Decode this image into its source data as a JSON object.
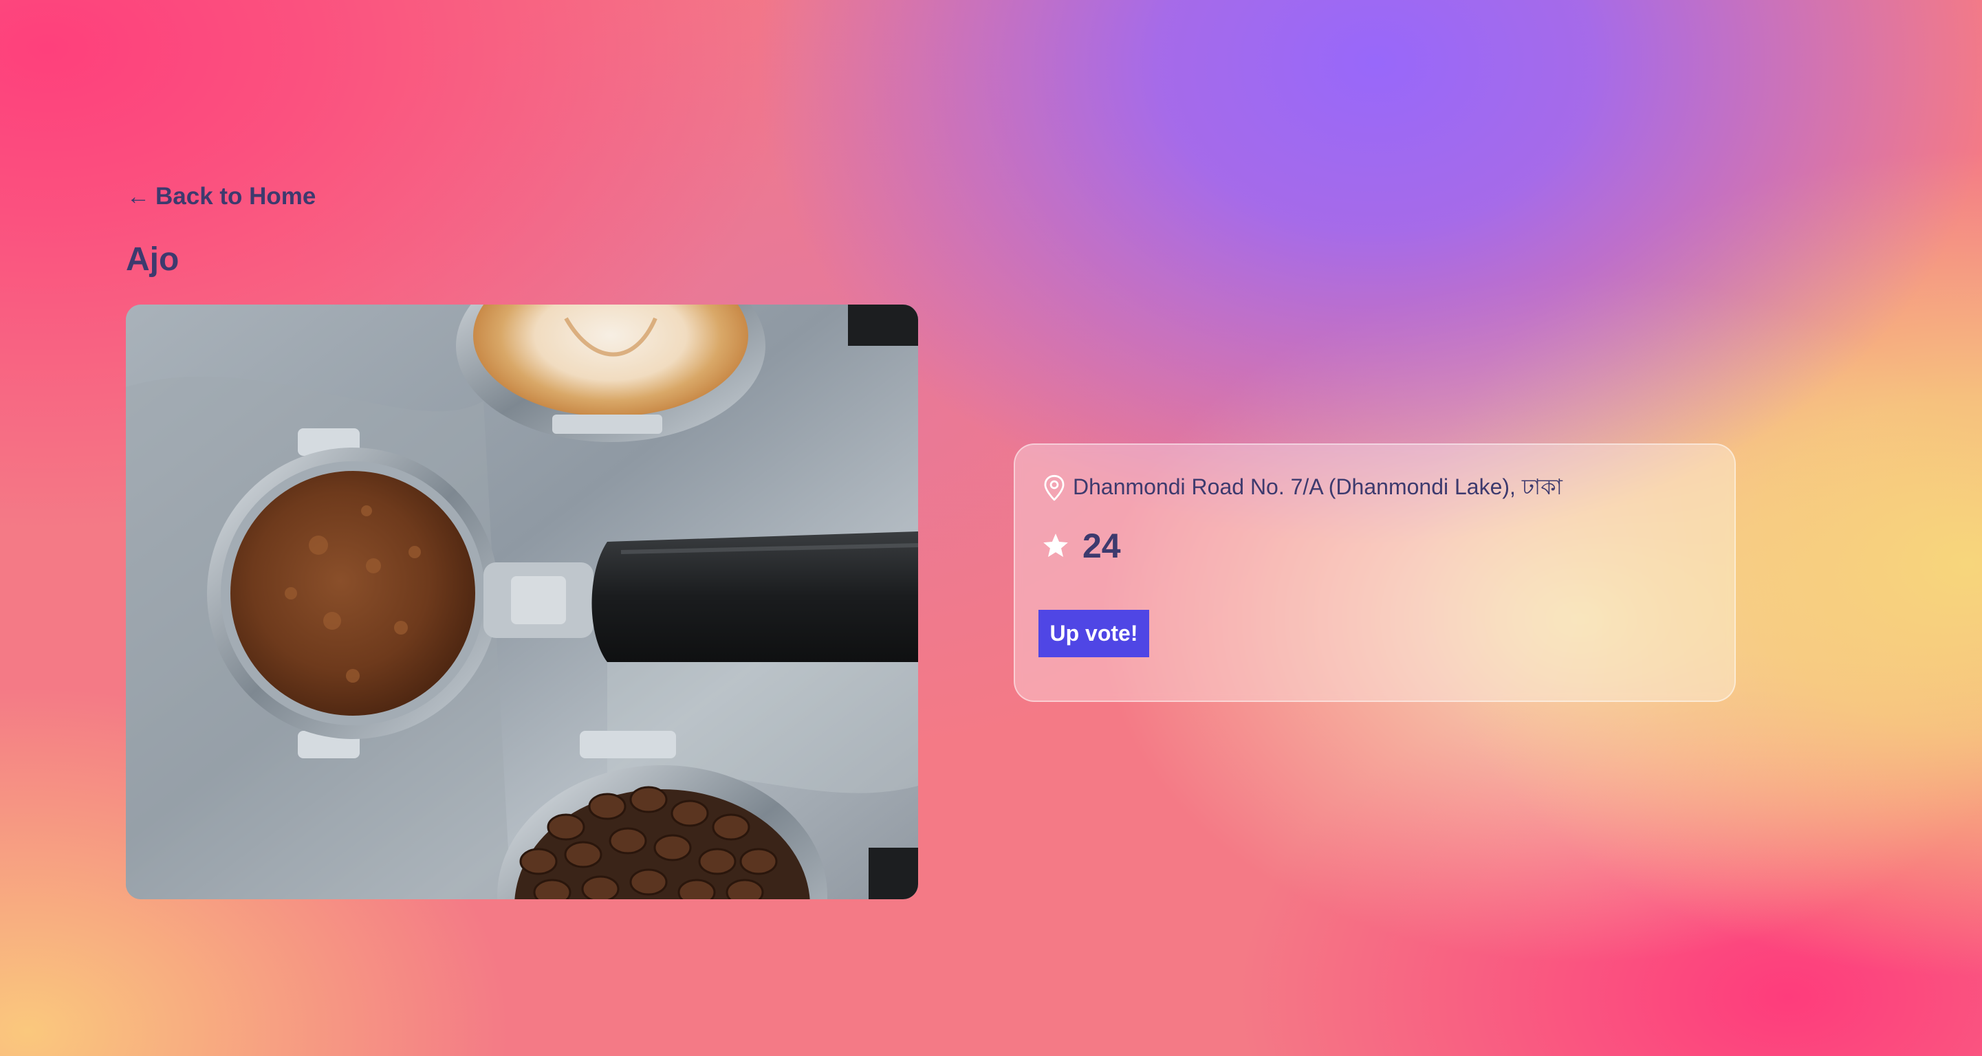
{
  "nav": {
    "back_label": "Back to Home",
    "back_icon": "arrow-left-icon"
  },
  "place": {
    "name": "Ajo",
    "image": {
      "icon": "coffee-portafilters-photo"
    },
    "location": "Dhanmondi Road No. 7/A (Dhanmondi Lake), ঢাকা",
    "location_icon": "map-pin-icon",
    "votes": "24",
    "votes_icon": "star-icon",
    "upvote_label": "Up vote!"
  },
  "colors": {
    "text": "#3d3a6e",
    "button": "#4f46e5",
    "button_text": "#ffffff",
    "gradient_pink": "#fe407c",
    "gradient_purple": "#9868fa",
    "gradient_yellow": "#f7d67c"
  }
}
